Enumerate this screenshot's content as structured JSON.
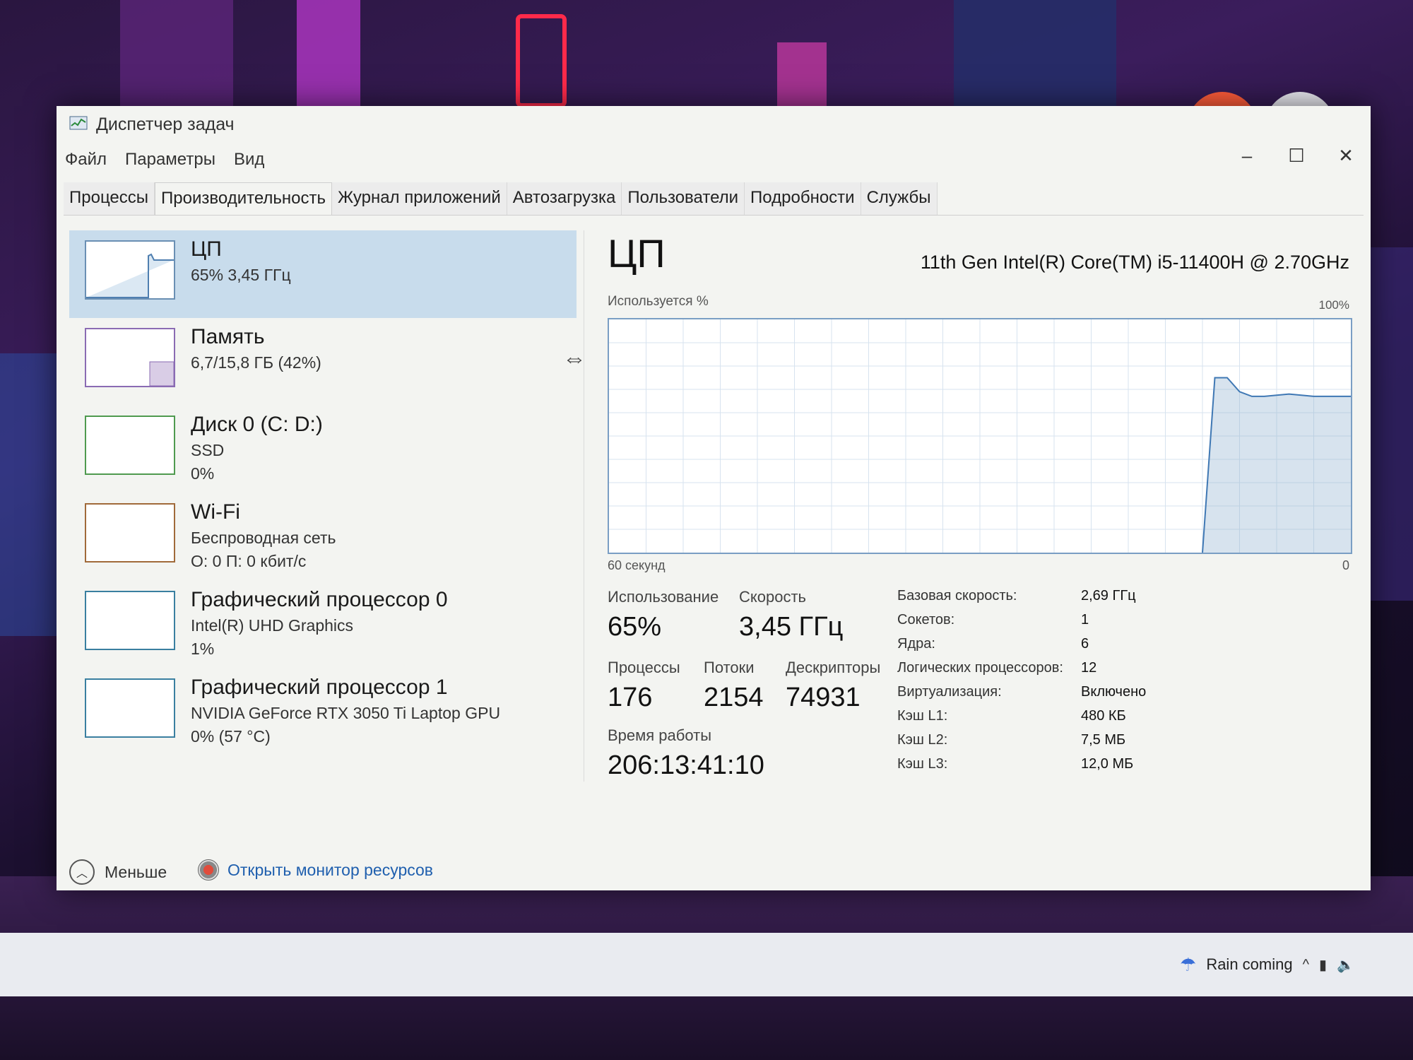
{
  "window": {
    "title": "Диспетчер задач",
    "minimize": "–",
    "maximize": "☐",
    "close": "✕"
  },
  "menu": [
    "Файл",
    "Параметры",
    "Вид"
  ],
  "tabs": [
    "Процессы",
    "Производительность",
    "Журнал приложений",
    "Автозагрузка",
    "Пользователи",
    "Подробности",
    "Службы"
  ],
  "active_tab": "Производительность",
  "sidebar": {
    "items": [
      {
        "title": "ЦП",
        "sub1": "65% 3,45 ГГц",
        "sub2": ""
      },
      {
        "title": "Память",
        "sub1": "6,7/15,8 ГБ (42%)",
        "sub2": ""
      },
      {
        "title": "Диск 0 (C: D:)",
        "sub1": "SSD",
        "sub2": "0%"
      },
      {
        "title": "Wi-Fi",
        "sub1": "Беспроводная сеть",
        "sub2": "О: 0 П: 0 кбит/с"
      },
      {
        "title": "Графический процессор 0",
        "sub1": "Intel(R) UHD Graphics",
        "sub2": "1%"
      },
      {
        "title": "Графический процессор 1",
        "sub1": "NVIDIA GeForce RTX 3050 Ti Laptop GPU",
        "sub2": "0% (57 °C)"
      }
    ],
    "splitter_glyph": "⇔"
  },
  "cpu": {
    "title": "ЦП",
    "model": "11th Gen Intel(R) Core(TM) i5-11400H @ 2.70GHz",
    "graph_label": "Используется %",
    "graph_max": "100%",
    "graph_time": "60 секунд",
    "graph_min": "0",
    "usage_label": "Использование",
    "usage_value": "65%",
    "speed_label": "Скорость",
    "speed_value": "3,45 ГГц",
    "processes_label": "Процессы",
    "processes_value": "176",
    "threads_label": "Потоки",
    "threads_value": "2154",
    "handles_label": "Дескрипторы",
    "handles_value": "74931",
    "uptime_label": "Время работы",
    "uptime_value": "206:13:41:10",
    "specs": [
      {
        "k": "Базовая скорость:",
        "v": "2,69 ГГц"
      },
      {
        "k": "Сокетов:",
        "v": "1"
      },
      {
        "k": "Ядра:",
        "v": "6"
      },
      {
        "k": "Логических процессоров:",
        "v": "12"
      },
      {
        "k": "Виртуализация:",
        "v": "Включено"
      },
      {
        "k": "Кэш L1:",
        "v": "480 КБ"
      },
      {
        "k": "Кэш L2:",
        "v": "7,5 МБ"
      },
      {
        "k": "Кэш L3:",
        "v": "12,0 МБ"
      }
    ]
  },
  "footer": {
    "less": "Меньше",
    "resmon": "Открыть монитор ресурсов"
  },
  "tray": {
    "weather": "Rain coming",
    "chevron": "^"
  },
  "chart_data": {
    "type": "area",
    "x": [
      0,
      48,
      49,
      50,
      51,
      52,
      53,
      55,
      57,
      60
    ],
    "values": [
      0,
      0,
      75,
      75,
      69,
      67,
      67,
      68,
      67,
      67
    ],
    "xlabel": "60 секунд",
    "ylabel": "Используется %",
    "ylim": [
      0,
      100
    ],
    "grid": true
  }
}
